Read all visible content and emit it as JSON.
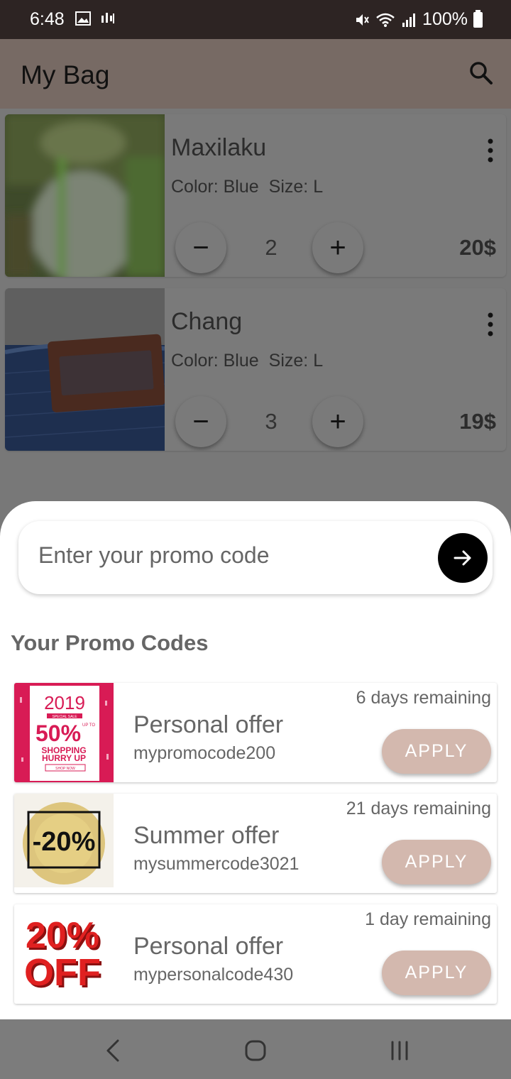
{
  "status_bar": {
    "time": "6:48",
    "battery": "100%"
  },
  "app_bar": {
    "title": "My Bag"
  },
  "cart": {
    "items": [
      {
        "name": "Maxilaku",
        "color_label": "Color: Blue",
        "size_label": "Size: L",
        "quantity": "2",
        "price": "20$",
        "minus": "−",
        "plus": "+"
      },
      {
        "name": "Chang",
        "color_label": "Color: Blue",
        "size_label": "Size: L",
        "quantity": "3",
        "price": "19$",
        "minus": "−",
        "plus": "+"
      }
    ]
  },
  "promo_sheet": {
    "input_placeholder": "Enter your promo code",
    "heading": "Your Promo Codes",
    "codes": [
      {
        "title": "Personal offer",
        "code": "mypromocode200",
        "remaining": "6 days remaining",
        "apply_label": "APPLY",
        "image_text": {
          "year": "2019",
          "tag": "SPECIAL SALE",
          "upto": "UP TO",
          "percent": "50%",
          "line1": "SHOPPING",
          "line2": "HURRY UP",
          "button": "SHOP NOW"
        }
      },
      {
        "title": "Summer offer",
        "code": "mysummercode3021",
        "remaining": "21 days remaining",
        "apply_label": "APPLY",
        "image_text": {
          "percent": "-20%"
        }
      },
      {
        "title": "Personal offer",
        "code": "mypersonalcode430",
        "remaining": "1 day remaining",
        "apply_label": "APPLY",
        "image_text": {
          "percent": "20%",
          "word": "OFF"
        }
      }
    ]
  },
  "colors": {
    "accent_apply": "#d3b8ae",
    "scrim": "#787878",
    "status_bar": "#2d2423",
    "app_bar": "#776a64"
  }
}
